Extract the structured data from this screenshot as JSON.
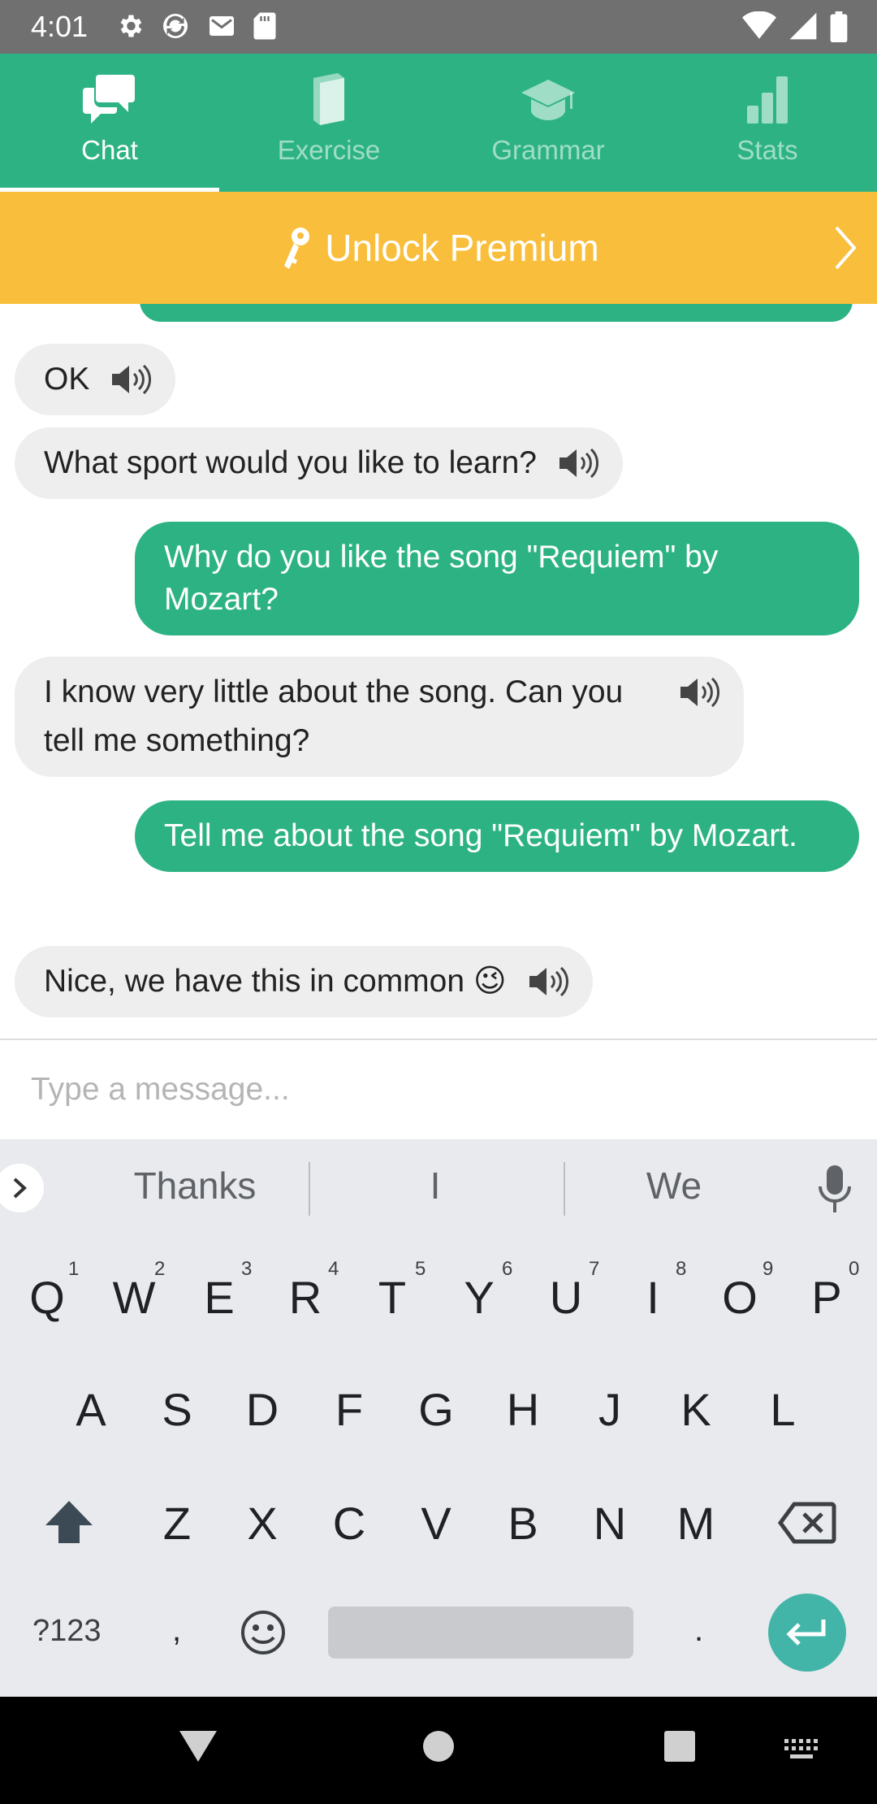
{
  "status_bar": {
    "time": "4:01",
    "left_icons": [
      "gear-icon",
      "sync-icon",
      "mail-icon",
      "sd-card-icon"
    ],
    "right_icons": [
      "wifi-icon",
      "signal-icon",
      "battery-icon"
    ]
  },
  "tabs": [
    {
      "label": "Chat",
      "icon": "chat-icon",
      "active": true
    },
    {
      "label": "Exercise",
      "icon": "book-icon",
      "active": false
    },
    {
      "label": "Grammar",
      "icon": "graduation-cap-icon",
      "active": false
    },
    {
      "label": "Stats",
      "icon": "bar-chart-icon",
      "active": false
    }
  ],
  "premium": {
    "label": "Unlock Premium",
    "icon": "key-icon"
  },
  "messages": [
    {
      "sender": "bot",
      "text": "OK"
    },
    {
      "sender": "bot",
      "text": "What sport would you like to learn?"
    },
    {
      "sender": "user",
      "text": "Why do you like the song \"Requiem\" by Mozart?"
    },
    {
      "sender": "bot",
      "text": "I know very little about the song. Can you tell me something?"
    },
    {
      "sender": "user",
      "text": "Tell me about the song \"Requiem\" by Mozart."
    },
    {
      "sender": "bot",
      "text": "Nice, we have this in common 😉"
    }
  ],
  "input": {
    "placeholder": "Type a message...",
    "value": ""
  },
  "keyboard": {
    "suggestions": [
      "Thanks",
      "I",
      "We"
    ],
    "row1": [
      "Q",
      "W",
      "E",
      "R",
      "T",
      "Y",
      "U",
      "I",
      "O",
      "P"
    ],
    "row1_hints": [
      "1",
      "2",
      "3",
      "4",
      "5",
      "6",
      "7",
      "8",
      "9",
      "0"
    ],
    "row2": [
      "A",
      "S",
      "D",
      "F",
      "G",
      "H",
      "J",
      "K",
      "L"
    ],
    "row3": [
      "Z",
      "X",
      "C",
      "V",
      "B",
      "N",
      "M"
    ],
    "symbols_key": "?123",
    "comma_key": ",",
    "period_key": "."
  },
  "colors": {
    "primary": "#2db383",
    "premium": "#f9be3b",
    "bot_bubble": "#eeeeee",
    "enter_key": "#42b5a8"
  }
}
